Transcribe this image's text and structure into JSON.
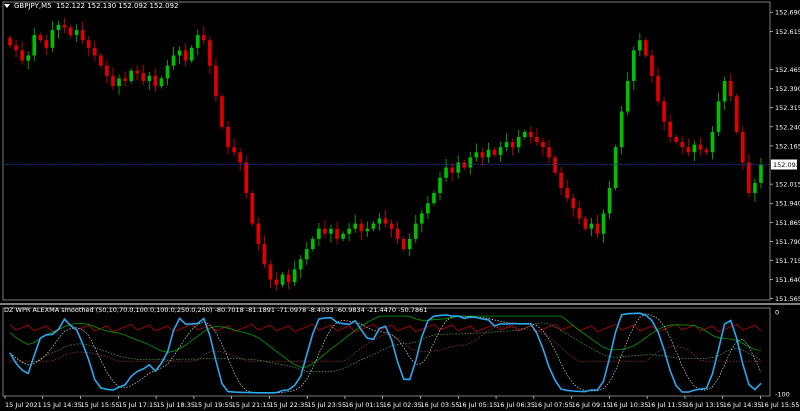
{
  "chart_title": {
    "symbol": "GBPJPY,M5",
    "ohlc": "152.122 152.130 152.092 152.092"
  },
  "indicator_title": "DZ WPR ALEXMA smoothed (50,10,70.0,100.0,100.0,250.0,250) -80.7018 -81.1891 -71.0978 -8.4033 -60.9834 -21.4470 -50.7861",
  "current_price": "152.092",
  "colors": {
    "bull": "#00c000",
    "bear": "#e00000",
    "wpr": "#2aa8f0",
    "grid_sep": "#808080",
    "price_line": "#2a3aa0"
  },
  "price_axis": [
    "152.690",
    "152.615",
    "152.465",
    "152.390",
    "152.315",
    "152.240",
    "152.165",
    "152.015",
    "151.940",
    "151.865",
    "151.790",
    "151.715",
    "151.640",
    "151.565"
  ],
  "indicator_axis": [
    "0",
    "-100"
  ],
  "time_axis": [
    "15 Jul 2021",
    "15 Jul 14:35",
    "15 Jul 15:55",
    "15 Jul 17:15",
    "15 Jul 18:35",
    "15 Jul 19:55",
    "15 Jul 21:15",
    "15 Jul 22:35",
    "15 Jul 23:55",
    "16 Jul 01:15",
    "16 Jul 02:35",
    "16 Jul 03:55",
    "16 Jul 05:15",
    "16 Jul 06:35",
    "16 Jul 07:55",
    "16 Jul 09:15",
    "16 Jul 10:35",
    "16 Jul 11:55",
    "16 Jul 13:15",
    "16 Jul 14:35",
    "16 Jul 15:55"
  ],
  "chart_data": {
    "type": "candlestick",
    "price_range": [
      151.56,
      152.73
    ],
    "closes": [
      152.56,
      152.54,
      152.5,
      152.52,
      152.6,
      152.58,
      152.55,
      152.62,
      152.64,
      152.63,
      152.6,
      152.62,
      152.58,
      152.55,
      152.52,
      152.48,
      152.44,
      152.4,
      152.43,
      152.42,
      152.46,
      152.45,
      152.42,
      152.44,
      152.4,
      152.43,
      152.48,
      152.52,
      152.54,
      152.5,
      152.55,
      152.6,
      152.58,
      152.48,
      152.36,
      152.24,
      152.16,
      152.14,
      152.1,
      151.98,
      151.86,
      151.78,
      151.7,
      151.64,
      151.62,
      151.66,
      151.63,
      151.68,
      151.72,
      151.76,
      151.8,
      151.84,
      151.82,
      151.84,
      151.8,
      151.82,
      151.84,
      151.86,
      151.83,
      151.84,
      151.86,
      151.88,
      151.86,
      151.84,
      151.8,
      151.76,
      151.8,
      151.86,
      151.9,
      151.94,
      151.98,
      152.04,
      152.08,
      152.06,
      152.1,
      152.08,
      152.12,
      152.14,
      152.12,
      152.15,
      152.13,
      152.16,
      152.18,
      152.16,
      152.2,
      152.22,
      152.2,
      152.18,
      152.16,
      152.12,
      152.06,
      152.0,
      151.96,
      151.92,
      151.88,
      151.84,
      151.86,
      151.82,
      151.9,
      152.0,
      152.16,
      152.3,
      152.42,
      152.54,
      152.58,
      152.52,
      152.44,
      152.34,
      152.26,
      152.2,
      152.18,
      152.16,
      152.14,
      152.17,
      152.15,
      152.14,
      152.22,
      152.34,
      152.42,
      152.36,
      152.22,
      152.1,
      151.98,
      152.02,
      152.09
    ]
  }
}
